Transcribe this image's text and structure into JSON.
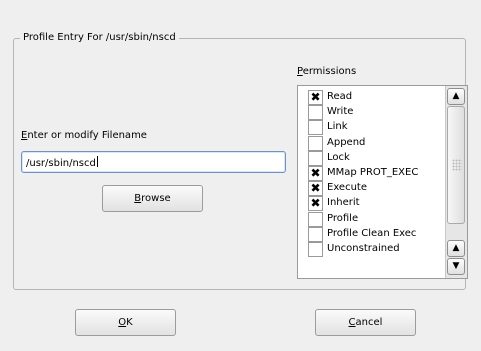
{
  "group": {
    "title": "Profile Entry For /usr/sbin/nscd"
  },
  "filename": {
    "label_mnemonic": "E",
    "label_rest": "nter or modify Filename",
    "value": "/usr/sbin/nscd"
  },
  "browse_button": {
    "mnemonic": "B",
    "rest": "rowse"
  },
  "permissions": {
    "label_mnemonic": "P",
    "label_rest": "ermissions",
    "items": [
      {
        "label": "Read",
        "checked": true
      },
      {
        "label": "Write",
        "checked": false
      },
      {
        "label": "Link",
        "checked": false
      },
      {
        "label": "Append",
        "checked": false
      },
      {
        "label": "Lock",
        "checked": false
      },
      {
        "label": "MMap PROT_EXEC",
        "checked": true
      },
      {
        "label": "Execute",
        "checked": true
      },
      {
        "label": "Inherit",
        "checked": true
      },
      {
        "label": "Profile",
        "checked": false
      },
      {
        "label": "Profile Clean Exec",
        "checked": false
      },
      {
        "label": "Unconstrained",
        "checked": false
      }
    ],
    "check_glyph": "✖"
  },
  "ok_button": {
    "mnemonic": "O",
    "rest": "K"
  },
  "cancel_button": {
    "mnemonic": "C",
    "rest": "ancel"
  },
  "scroll_icons": {
    "up": "▲",
    "down": "▼"
  }
}
